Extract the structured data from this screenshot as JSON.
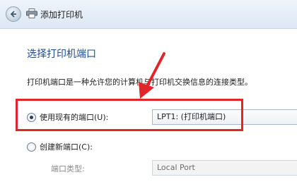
{
  "window": {
    "title": "添加打印机",
    "back_icon": "back-arrow-icon",
    "app_icon": "printer-icon"
  },
  "main": {
    "heading": "选择打印机端口",
    "description": "打印机端口是一种允许您的计算机与打印机交换信息的连接类型。",
    "use_existing": {
      "label": "使用现有的端口(U):",
      "selected": true,
      "value": "LPT1: (打印机端口)"
    },
    "create_new": {
      "label": "创建新端口(C):",
      "selected": false,
      "port_type_label": "端口类型:",
      "port_type_value": "Local Port"
    }
  },
  "annotation": {
    "color": "#e0262a"
  }
}
